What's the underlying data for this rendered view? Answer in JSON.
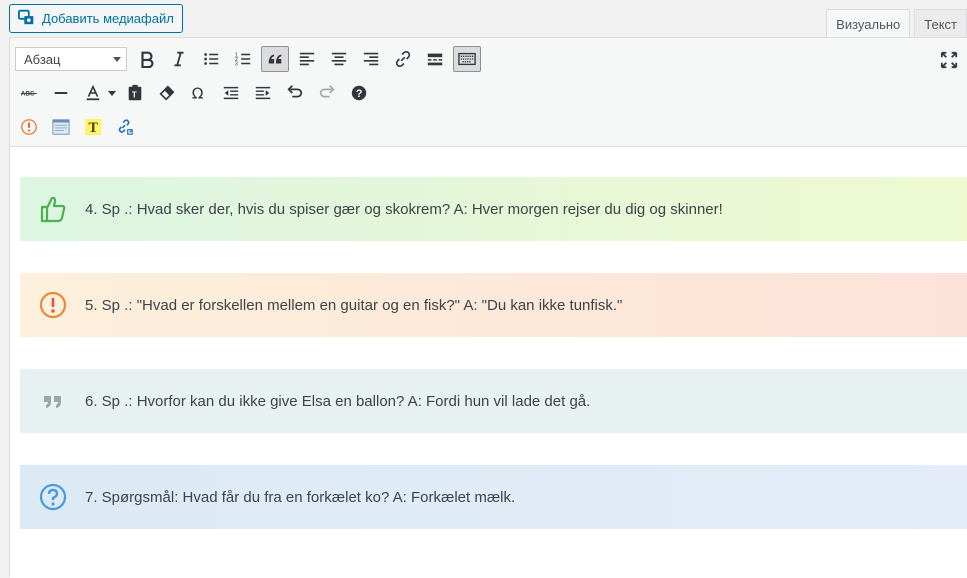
{
  "media_button": {
    "label": "Добавить медиафайл",
    "icon": "media-icon"
  },
  "tabs": [
    {
      "label": "Визуально",
      "active": true
    },
    {
      "label": "Текст",
      "active": false
    }
  ],
  "toolbar": {
    "format_select": "Абзац",
    "row1_icons": [
      "bold-icon",
      "italic-icon",
      "bullet-list-icon",
      "numbered-list-icon",
      "blockquote-icon",
      "align-left-icon",
      "align-center-icon",
      "align-right-icon",
      "link-icon",
      "read-more-icon",
      "toolbar-toggle-icon"
    ],
    "row2_icons": [
      "strikethrough-icon",
      "horizontal-line-icon",
      "text-color-icon",
      "paste-text-icon",
      "clear-formatting-icon",
      "special-character-icon",
      "outdent-icon",
      "indent-icon",
      "undo-icon",
      "redo-icon",
      "help-icon"
    ],
    "row3_icons": [
      "alert-plugin-icon",
      "template-plugin-icon",
      "highlight-plugin-icon",
      "external-link-plugin-icon"
    ]
  },
  "boxes": [
    {
      "icon": "thumbs-up-icon",
      "text": "4. Sp .: Hvad sker der, hvis du spiser gær og skokrem? A: Hver morgen rejser du dig og skinner!",
      "color": "#4caf50"
    },
    {
      "icon": "exclamation-circle-icon",
      "text": "5. Sp .: \"Hvad er forskellen mellem en guitar og en fisk?\" A: \"Du kan ikke tunfisk.\"",
      "color": "#e8883a"
    },
    {
      "icon": "quote-icon",
      "text": "6. Sp .: Hvorfor kan du ikke give Elsa en ballon? A: Fordi hun vil lade det gå.",
      "color": "#9aa5ad"
    },
    {
      "icon": "question-circle-icon",
      "text": "7. Spørgsmål: Hvad får du fra en forkælet ko? A: Forkælet mælk.",
      "color": "#4a9ad8"
    }
  ]
}
